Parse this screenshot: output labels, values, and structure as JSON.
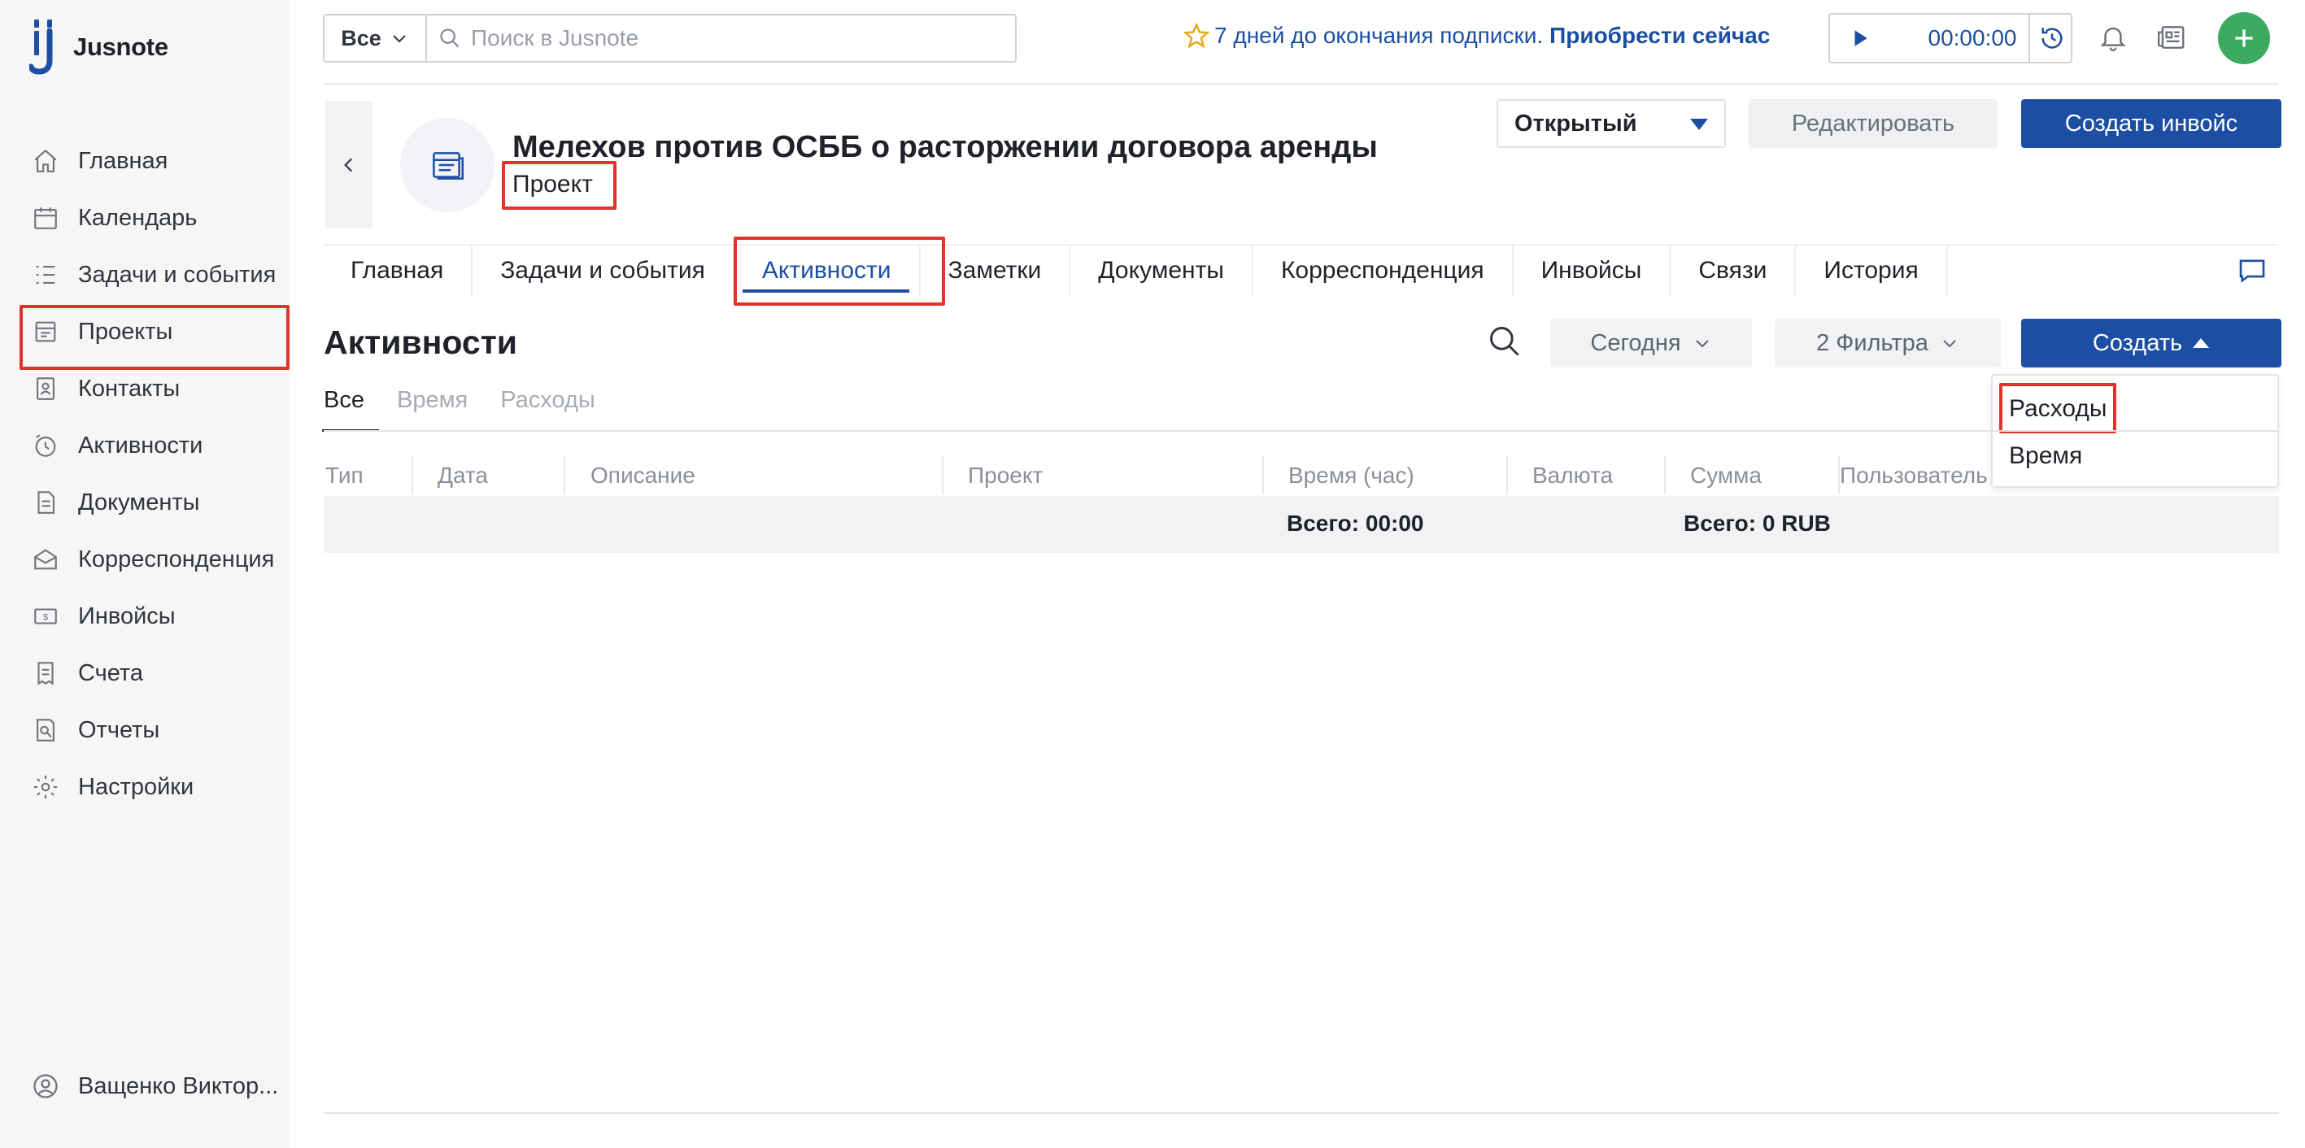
{
  "app": {
    "name": "Jusnote",
    "brand_color": "#1c4fa3",
    "highlight_color": "#e0342b"
  },
  "sidebar": {
    "items": [
      {
        "label": "Главная",
        "icon": "home-icon"
      },
      {
        "label": "Календарь",
        "icon": "calendar-icon"
      },
      {
        "label": "Задачи и события",
        "icon": "tasks-icon"
      },
      {
        "label": "Проекты",
        "icon": "projects-icon",
        "highlighted": true
      },
      {
        "label": "Контакты",
        "icon": "contacts-icon"
      },
      {
        "label": "Активности",
        "icon": "activities-icon"
      },
      {
        "label": "Документы",
        "icon": "documents-icon"
      },
      {
        "label": "Корреспонденция",
        "icon": "correspondence-icon"
      },
      {
        "label": "Инвойсы",
        "icon": "invoices-icon"
      },
      {
        "label": "Счета",
        "icon": "accounts-icon"
      },
      {
        "label": "Отчеты",
        "icon": "reports-icon"
      },
      {
        "label": "Настройки",
        "icon": "settings-icon"
      }
    ],
    "user": {
      "label": "Ващенко Виктор..."
    }
  },
  "topbar": {
    "scope": "Все",
    "search_placeholder": "Поиск в Jusnote",
    "promo_text": "7 дней до окончания подписки.",
    "promo_link": "Приобрести сейчас",
    "timer": "00:00:00"
  },
  "project": {
    "title": "Мелехов против ОСББ о расторжении договора аренды",
    "type": "Проект",
    "status": "Открытый",
    "edit_label": "Редактировать",
    "invoice_label": "Создать инвойс"
  },
  "tabs": [
    "Главная",
    "Задачи и события",
    "Активности",
    "Заметки",
    "Документы",
    "Корреспонденция",
    "Инвойсы",
    "Связи",
    "История"
  ],
  "active_tab": "Активности",
  "section": {
    "title": "Активности",
    "period": "Сегодня",
    "filters": "2 Фильтра",
    "create_label": "Создать",
    "create_menu": [
      "Расходы",
      "Время"
    ],
    "subtabs": [
      "Все",
      "Время",
      "Расходы"
    ]
  },
  "table": {
    "columns": [
      "Тип",
      "Дата",
      "Описание",
      "Проект",
      "Время (час)",
      "Валюта",
      "Сумма",
      "Пользователь"
    ],
    "total_time": "Всего: 00:00",
    "total_sum": "Всего: 0 RUB"
  }
}
